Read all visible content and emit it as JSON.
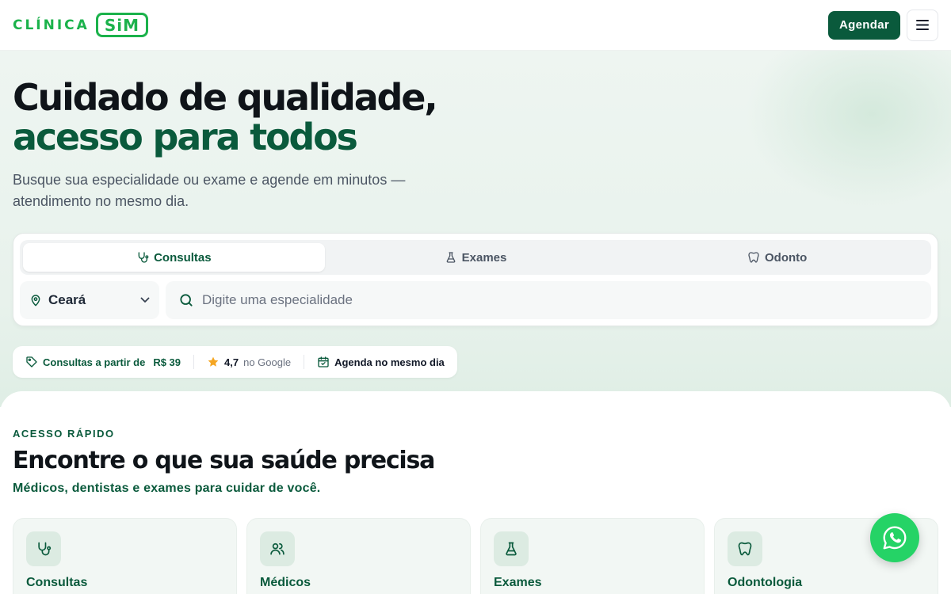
{
  "header": {
    "logo_text": "CLÍNICA",
    "logo_badge": "SiM",
    "cta_label": "Agendar",
    "menu_icon": "hamburger-icon"
  },
  "hero": {
    "title_line1": "Cuidado de qualidade,",
    "title_line2": "acesso para todos",
    "subtitle": "Busque sua especialidade ou exame e agende em minutos — atendimento no mesmo dia."
  },
  "search": {
    "tabs": [
      {
        "label": "Consultas",
        "icon": "stethoscope-icon",
        "active": true
      },
      {
        "label": "Exames",
        "icon": "flask-icon",
        "active": false
      },
      {
        "label": "Odonto",
        "icon": "tooth-icon",
        "active": false
      }
    ],
    "state_value": "Ceará",
    "placeholder": "Digite uma especialidade"
  },
  "trust": {
    "price_label": "Consultas a partir de",
    "price_value": "R$ 39",
    "rating_value": "4,7",
    "rating_source": "no Google",
    "same_day": "Agenda no mesmo dia"
  },
  "quick_access": {
    "eyebrow": "ACESSO RÁPIDO",
    "title": "Encontre o que sua saúde precisa",
    "subtitle": "Médicos, dentistas e exames para cuidar de você.",
    "cards": [
      {
        "title": "Consultas",
        "icon": "stethoscope-icon"
      },
      {
        "title": "Médicos",
        "icon": "users-icon"
      },
      {
        "title": "Exames",
        "icon": "flask-icon"
      },
      {
        "title": "Odontologia",
        "icon": "tooth-icon"
      }
    ]
  },
  "colors": {
    "brand_green": "#1bb24b",
    "dark_green": "#0a5a3c",
    "whatsapp": "#25d366"
  }
}
